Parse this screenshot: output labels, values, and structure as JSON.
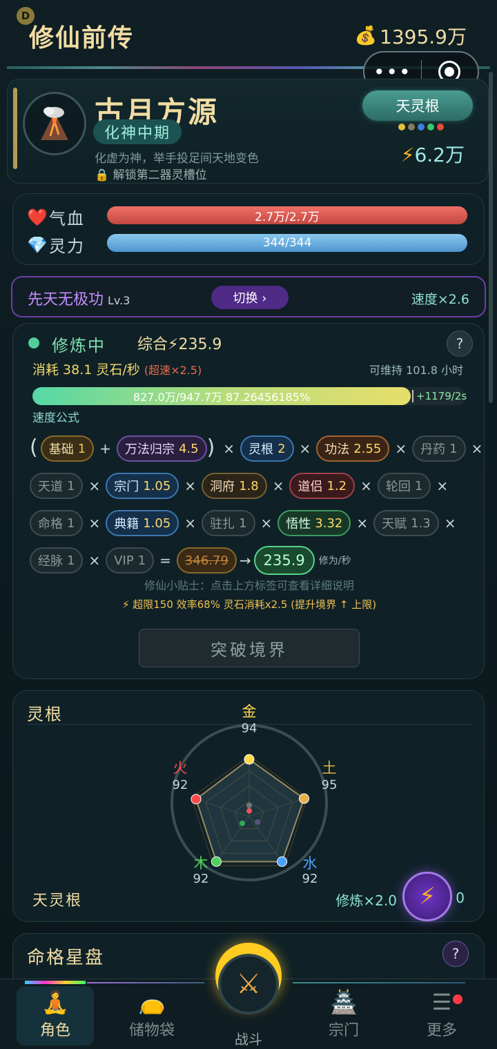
{
  "header": {
    "badge": "D",
    "title": "修仙前传",
    "money_icon": "money-bag-icon",
    "money": "1395.9万",
    "capsule": {
      "more": "•••",
      "close": "target-icon"
    }
  },
  "profile": {
    "name": "古月方源",
    "realm": "化神中期",
    "description": "化虚为神，举手投足间天地变色",
    "unlock_text": "解锁第二器灵槽位",
    "spirit_root_button": "天灵根",
    "root_colors": [
      "#e6c23a",
      "#8b7a5c",
      "#3f7fdc",
      "#3fc46a",
      "#e84a3a"
    ],
    "power": "6.2万"
  },
  "stats": {
    "hp_label": "气血",
    "hp_value": "2.7万/2.7万",
    "mp_label": "灵力",
    "mp_value": "344/344",
    "hp_fraction": 1.0,
    "mp_fraction": 1.0
  },
  "technique": {
    "name": "先天无极功",
    "level": "Lv.3",
    "switch_label": "切换 ›",
    "speed": "速度×2.6"
  },
  "cultivation": {
    "status": "修炼中",
    "total": "综合⚡235.9",
    "consume": "消耗 38.1 灵石/秒",
    "overspeed": "(超速×2.5)",
    "sustain": "可维持 101.8 小时",
    "progress_text": "827.0万/947.7万  87.26456185%",
    "progress_fraction": 0.8726,
    "rate": "+1179/2s",
    "formula_title": "速度公式",
    "rows": [
      [
        {
          "t": "paren",
          "s": "("
        },
        {
          "t": "chip",
          "c": "c-gold",
          "k": "基础",
          "v": "1"
        },
        {
          "t": "op",
          "s": "+"
        },
        {
          "t": "chip",
          "c": "c-purple",
          "k": "万法归宗",
          "v": "4.5"
        },
        {
          "t": "paren",
          "s": ")"
        },
        {
          "t": "op",
          "s": "×"
        },
        {
          "t": "chip",
          "c": "c-blue",
          "k": "灵根",
          "v": "2"
        },
        {
          "t": "op",
          "s": "×"
        },
        {
          "t": "chip",
          "c": "c-orange",
          "k": "功法",
          "v": "2.55"
        },
        {
          "t": "op",
          "s": "×"
        },
        {
          "t": "chip",
          "c": "c-grey",
          "k": "丹药",
          "v": "1"
        },
        {
          "t": "op",
          "s": "×"
        }
      ],
      [
        {
          "t": "chip",
          "c": "c-grey",
          "k": "天道",
          "v": "1"
        },
        {
          "t": "op",
          "s": "×"
        },
        {
          "t": "chip",
          "c": "c-blue",
          "k": "宗门",
          "v": "1.05"
        },
        {
          "t": "op",
          "s": "×"
        },
        {
          "t": "chip",
          "c": "c-brown",
          "k": "洞府",
          "v": "1.8"
        },
        {
          "t": "op",
          "s": "×"
        },
        {
          "t": "chip",
          "c": "c-red",
          "k": "道侣",
          "v": "1.2"
        },
        {
          "t": "op",
          "s": "×"
        },
        {
          "t": "chip",
          "c": "c-grey",
          "k": "轮回",
          "v": "1"
        },
        {
          "t": "op",
          "s": "×"
        }
      ],
      [
        {
          "t": "chip",
          "c": "c-grey",
          "k": "命格",
          "v": "1"
        },
        {
          "t": "op",
          "s": "×"
        },
        {
          "t": "chip",
          "c": "c-blue",
          "k": "典籍",
          "v": "1.05"
        },
        {
          "t": "op",
          "s": "×"
        },
        {
          "t": "chip",
          "c": "c-grey",
          "k": "驻扎",
          "v": "1"
        },
        {
          "t": "op",
          "s": "×"
        },
        {
          "t": "chip",
          "c": "c-green",
          "k": "悟性",
          "v": "3.32"
        },
        {
          "t": "op",
          "s": "×"
        },
        {
          "t": "chip",
          "c": "c-grey",
          "k": "天赋",
          "v": "1.3"
        },
        {
          "t": "op",
          "s": "×"
        }
      ],
      [
        {
          "t": "chip",
          "c": "c-grey",
          "k": "经脉",
          "v": "1"
        },
        {
          "t": "op",
          "s": "×"
        },
        {
          "t": "chip",
          "c": "c-grey",
          "k": "VIP",
          "v": "1"
        },
        {
          "t": "op",
          "s": "="
        },
        {
          "t": "old",
          "s": "346.79"
        },
        {
          "t": "arrow",
          "s": "→"
        },
        {
          "t": "result",
          "s": "235.9"
        },
        {
          "t": "unit",
          "s": "修为/秒"
        }
      ]
    ],
    "tip": "修仙小贴士：点击上方标签可查看详细说明",
    "limit": "⚡ 超限150 效率68% 灵石消耗x2.5 (提升境界 ↑ 上限)",
    "break_button": "突破境界"
  },
  "spirit_root": {
    "title": "灵根",
    "chart_data": {
      "type": "radar",
      "categories": [
        "金",
        "土",
        "水",
        "木",
        "火"
      ],
      "values": [
        94,
        95,
        92,
        92,
        92
      ],
      "colors": [
        "#ffd94a",
        "#e8b04a",
        "#4aa0ff",
        "#4fd05a",
        "#ff4a4a"
      ]
    },
    "name": "天灵根",
    "multiplier": "修炼×2.0",
    "count": "0"
  },
  "star_chart": {
    "title": "命格星盘",
    "help": "?"
  },
  "tabbar": {
    "tabs": [
      {
        "label": "角色",
        "icon": "meditation-icon"
      },
      {
        "label": "储物袋",
        "icon": "bag-icon"
      },
      {
        "label": "战斗",
        "icon": "crossed-swords-icon"
      },
      {
        "label": "宗门",
        "icon": "temple-icon"
      },
      {
        "label": "更多",
        "icon": "menu-icon"
      }
    ]
  }
}
